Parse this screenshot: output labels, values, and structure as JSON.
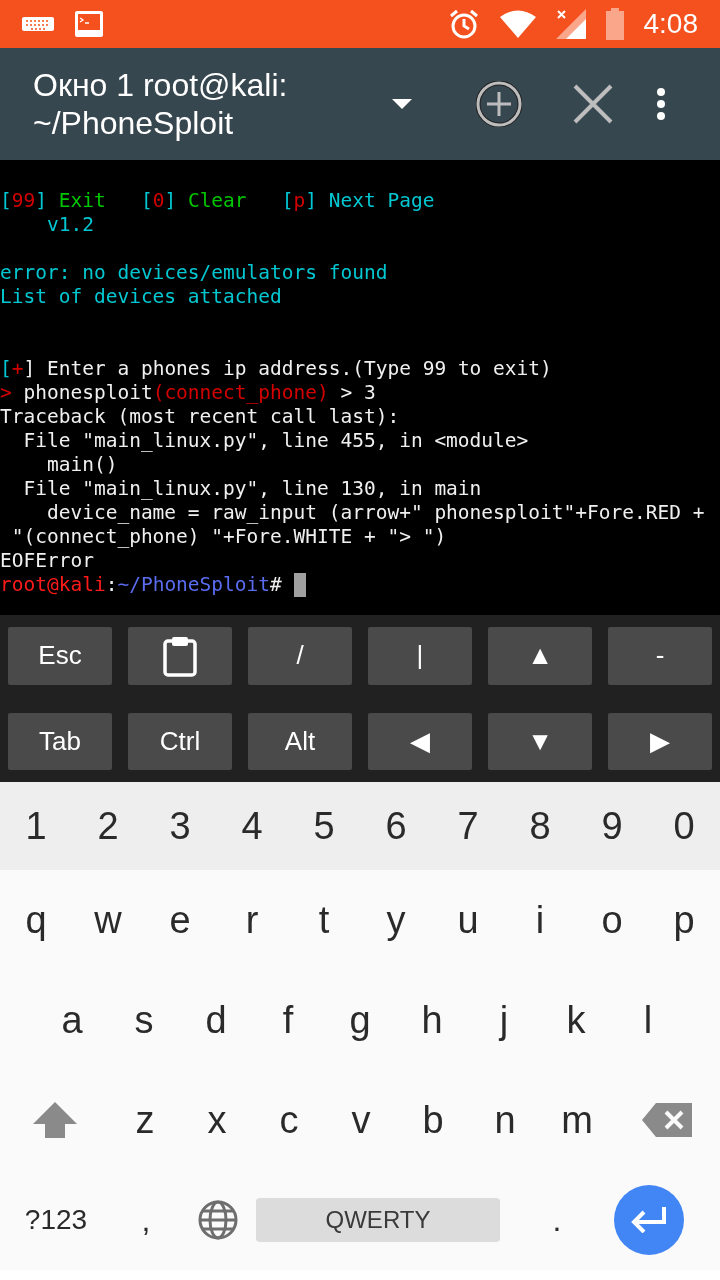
{
  "status_bar": {
    "time": "4:08"
  },
  "toolbar": {
    "title": "Окно 1 root@kali: ~/PhoneSploit"
  },
  "terminal": {
    "lines": [
      {
        "kind": "text",
        "segments": [
          {
            "text": "[",
            "color": "#00c8d2"
          },
          {
            "text": "99",
            "color": "#d40000"
          },
          {
            "text": "] ",
            "color": "#00c8d2"
          },
          {
            "text": "Exit",
            "color": "#00c800"
          },
          {
            "text": "   [",
            "color": "#00c8d2"
          },
          {
            "text": "0",
            "color": "#d40000"
          },
          {
            "text": "] ",
            "color": "#00c8d2"
          },
          {
            "text": "Clear",
            "color": "#00c800"
          },
          {
            "text": "   [",
            "color": "#00c8d2"
          },
          {
            "text": "p",
            "color": "#d40000"
          },
          {
            "text": "] Next Page",
            "color": "#00c8d2"
          }
        ]
      },
      {
        "kind": "text",
        "segments": [
          {
            "text": "    v1.2",
            "color": "#00c8d2"
          }
        ]
      },
      {
        "kind": "blank"
      },
      {
        "kind": "text",
        "segments": [
          {
            "text": "error: no devices/emulators found",
            "color": "#00c8d2"
          }
        ]
      },
      {
        "kind": "text",
        "segments": [
          {
            "text": "List of devices attached",
            "color": "#00c8d2"
          }
        ]
      },
      {
        "kind": "blank"
      },
      {
        "kind": "blank"
      },
      {
        "kind": "text",
        "segments": [
          {
            "text": "[",
            "color": "#00c8d2"
          },
          {
            "text": "+",
            "color": "#d40000"
          },
          {
            "text": "] Enter a phones ip address.(Type 99 to exit)",
            "color": "#f0f0f0"
          }
        ]
      },
      {
        "kind": "text",
        "segments": [
          {
            "text": ">",
            "color": "#d40000"
          },
          {
            "text": " phonesploit",
            "color": "#f0f0f0"
          },
          {
            "text": "(connect_phone)",
            "color": "#d40000"
          },
          {
            "text": " > 3",
            "color": "#f0f0f0"
          }
        ]
      },
      {
        "kind": "text",
        "segments": [
          {
            "text": "Traceback (most recent call last):",
            "color": "#f0f0f0"
          }
        ]
      },
      {
        "kind": "text",
        "segments": [
          {
            "text": "  File \"main_linux.py\", line 455, in <module>",
            "color": "#f0f0f0"
          }
        ]
      },
      {
        "kind": "text",
        "segments": [
          {
            "text": "    main()",
            "color": "#f0f0f0"
          }
        ]
      },
      {
        "kind": "text",
        "segments": [
          {
            "text": "  File \"main_linux.py\", line 130, in main",
            "color": "#f0f0f0"
          }
        ]
      },
      {
        "kind": "text",
        "segments": [
          {
            "text": "    device_name = raw_input (arrow+\" phonesploit\"+Fore.RED +",
            "color": "#f0f0f0"
          }
        ]
      },
      {
        "kind": "text",
        "segments": [
          {
            "text": " \"(connect_phone) \"+Fore.WHITE + \"> \")",
            "color": "#f0f0f0"
          }
        ]
      },
      {
        "kind": "text",
        "segments": [
          {
            "text": "EOFError",
            "color": "#f0f0f0"
          }
        ]
      },
      {
        "kind": "prompt",
        "segments": [
          {
            "text": "root@kali",
            "color": "#ff1a1a"
          },
          {
            "text": ":",
            "color": "#f0f0f0"
          },
          {
            "text": "~/PhoneSploit",
            "color": "#5a6cf0"
          },
          {
            "text": "# ",
            "color": "#f0f0f0"
          }
        ]
      }
    ]
  },
  "extra_keys": [
    {
      "kind": "text",
      "label": "Esc"
    },
    {
      "kind": "icon"
    },
    {
      "kind": "text",
      "label": "/"
    },
    {
      "kind": "text",
      "label": "|"
    },
    {
      "kind": "text",
      "label": "▲"
    },
    {
      "kind": "text",
      "label": "-"
    },
    {
      "kind": "text",
      "label": "Tab"
    },
    {
      "kind": "text",
      "label": "Ctrl"
    },
    {
      "kind": "text",
      "label": "Alt"
    },
    {
      "kind": "text",
      "label": "◀"
    },
    {
      "kind": "text",
      "label": "▼"
    },
    {
      "kind": "text",
      "label": "▶"
    }
  ],
  "keyboard": {
    "number_row": [
      "1",
      "2",
      "3",
      "4",
      "5",
      "6",
      "7",
      "8",
      "9",
      "0"
    ],
    "row_1": [
      "q",
      "w",
      "e",
      "r",
      "t",
      "y",
      "u",
      "i",
      "o",
      "p"
    ],
    "row_2": [
      "a",
      "s",
      "d",
      "f",
      "g",
      "h",
      "j",
      "k",
      "l"
    ],
    "row_3": [
      "z",
      "x",
      "c",
      "v",
      "b",
      "n",
      "m"
    ],
    "symbols_key": "?123",
    "comma_key": ",",
    "space_key": "QWERTY",
    "period_key": "."
  }
}
